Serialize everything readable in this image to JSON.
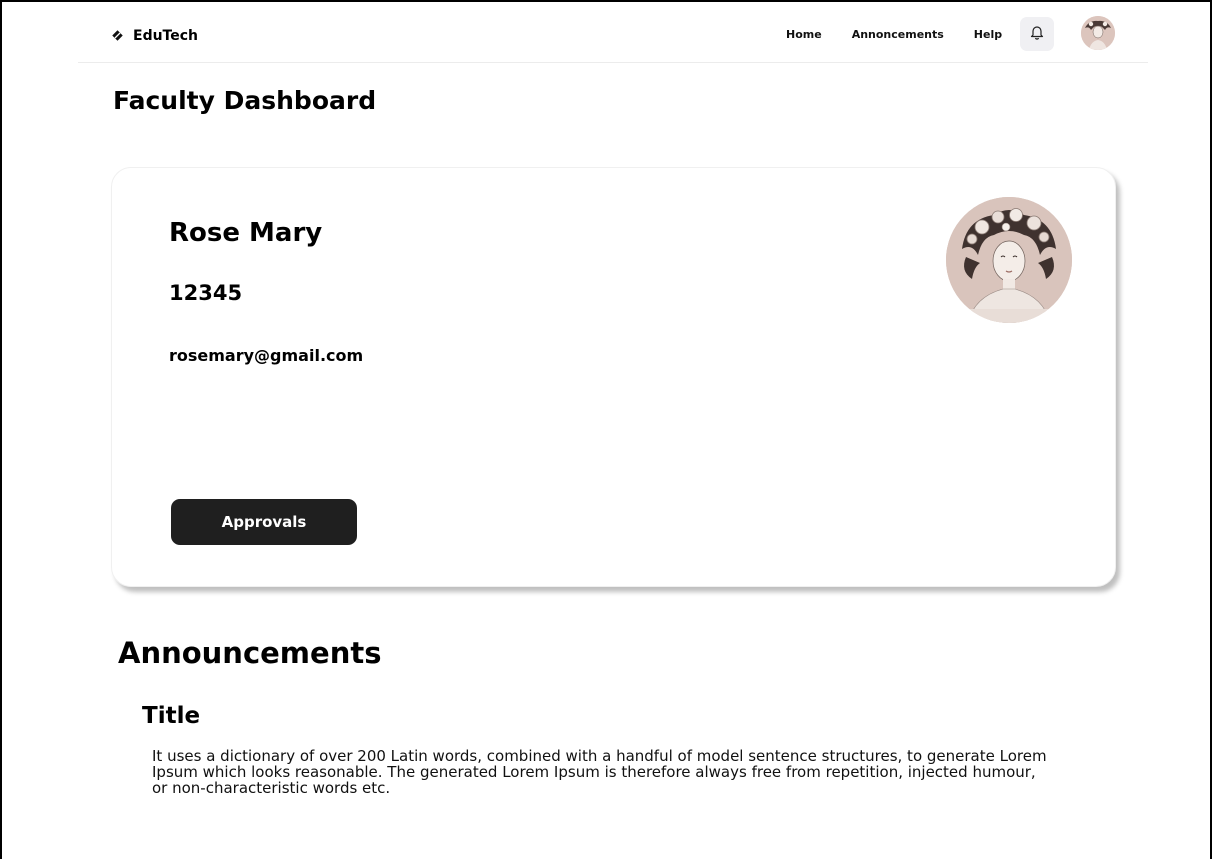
{
  "brand": {
    "name": "EduTech",
    "icon": "diamond-logo-icon"
  },
  "nav": {
    "links": [
      "Home",
      "Annoncements",
      "Help"
    ],
    "notification_icon": "bell-icon",
    "avatar_icon": "user-avatar"
  },
  "page": {
    "title": "Faculty Dashboard"
  },
  "profile": {
    "name": "Rose Mary",
    "id": "12345",
    "email": "rosemary@gmail.com",
    "approvals_label": "Approvals"
  },
  "announcements": {
    "heading": "Announcements",
    "items": [
      {
        "title": "Title",
        "body": "It uses a dictionary of over 200 Latin words, combined with a handful of model sentence structures, to generate Lorem Ipsum which looks reasonable. The generated Lorem Ipsum is therefore always free from repetition, injected humour, or non-characteristic words etc."
      }
    ]
  },
  "colors": {
    "button_bg": "#1f1f1f",
    "avatar_bg": "#d9c4bc",
    "bell_bg": "#f0f0f3"
  }
}
